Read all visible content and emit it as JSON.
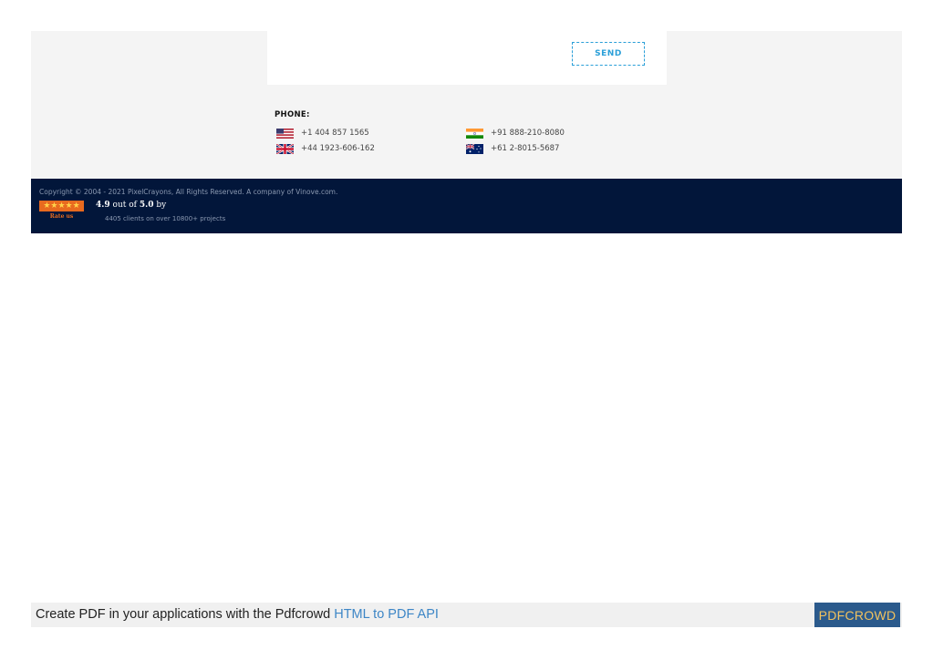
{
  "contact_form": {
    "send_label": "SEND"
  },
  "phone": {
    "heading": "PHONE:",
    "numbers": [
      {
        "country": "us",
        "flag_icon": "us-flag-icon",
        "number": "+1 404 857 1565"
      },
      {
        "country": "in",
        "flag_icon": "india-flag-icon",
        "number": "+91 888-210-8080"
      },
      {
        "country": "uk",
        "flag_icon": "uk-flag-icon",
        "number": "+44 1923-606-162"
      },
      {
        "country": "au",
        "flag_icon": "australia-flag-icon",
        "number": "+61 2-8015-5687"
      }
    ]
  },
  "footer": {
    "copyright": "Copyright © 2004 - 2021 PixelCrayons, All Rights Reserved. A company of Vinove.com.",
    "rating_stars": "★★★★★",
    "rate_us": "Rate us",
    "rating_score": "4.9",
    "rating_out_of": "out of",
    "rating_max": "5.0",
    "rating_by": "by",
    "clients": "4405 clients on over 10800+ projects"
  },
  "pdf_banner": {
    "prefix": "Create PDF in your applications with the Pdfcrowd ",
    "link_text": "HTML to PDF API",
    "brand": "PDFCROWD"
  },
  "colors": {
    "accent": "#2a9fd8",
    "footer_bg": "#02163a",
    "badge": "#e86a1f",
    "pdf_brand_bg": "#2b5a8c"
  }
}
